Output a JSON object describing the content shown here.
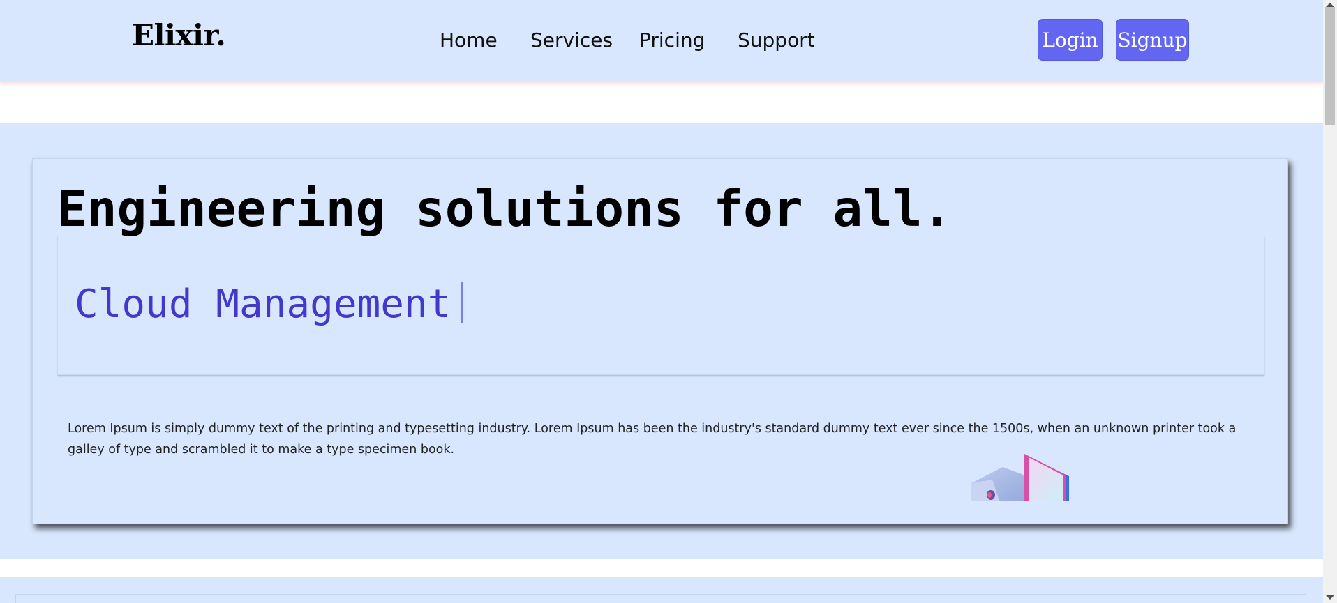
{
  "brand": {
    "logo": "Elixir."
  },
  "nav": {
    "items": [
      {
        "label": "Home"
      },
      {
        "label": "Services"
      },
      {
        "label": "Pricing"
      },
      {
        "label": "Support"
      }
    ],
    "login_label": "Login",
    "signup_label": "Signup"
  },
  "hero": {
    "headline": "Engineering solutions for all.",
    "typed_text": "Cloud Management",
    "description": "Lorem Ipsum is simply dummy text of the printing and typesetting industry. Lorem Ipsum has been the industry's standard dummy text ever since the 1500s, when an unknown printer took a galley of type and scrambled it to make a type specimen book."
  },
  "colors": {
    "background": "#d8e7fd",
    "accent": "#6366f1",
    "typed_text": "#4338ca"
  },
  "icons": {
    "illustration": "computer-illustration-icon"
  }
}
